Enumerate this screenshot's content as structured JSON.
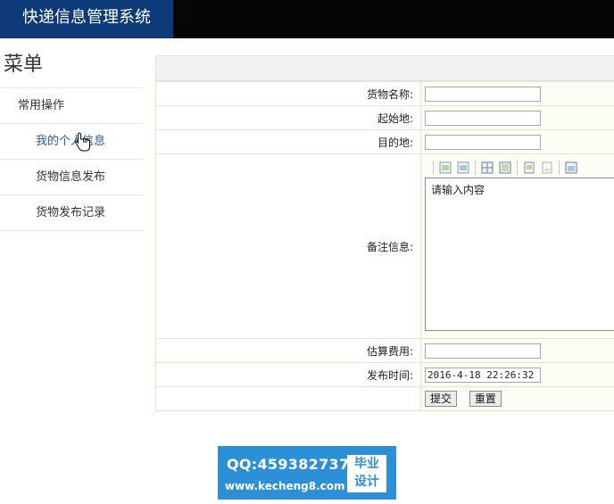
{
  "header": {
    "title": "快递信息管理系统"
  },
  "sidebar": {
    "title": "菜单",
    "items": [
      {
        "label": "常用操作"
      },
      {
        "label": "我的个人信息"
      },
      {
        "label": "货物信息发布"
      },
      {
        "label": "货物发布记录"
      }
    ]
  },
  "form": {
    "fields": {
      "name": {
        "label": "货物名称:",
        "value": ""
      },
      "origin": {
        "label": "起始地:",
        "value": ""
      },
      "dest": {
        "label": "目的地:",
        "value": ""
      },
      "remark": {
        "label": "备注信息:",
        "placeholder": "请输入内容"
      },
      "cost": {
        "label": "估算费用:",
        "value": ""
      },
      "time": {
        "label": "发布时间:",
        "value": "2016-4-18 22:26:32"
      }
    },
    "buttons": {
      "submit": "提交",
      "reset": "重置"
    }
  },
  "watermark": {
    "qq": "QQ:459382737",
    "url": "www.kecheng8.com",
    "badge_line1": "毕业",
    "badge_line2": "设计"
  },
  "colors": {
    "header_bg": "#050505",
    "title_bg": "#0d3b7a",
    "active_link": "#2d5f92",
    "watermark_bg": "#2d8fd6"
  },
  "icons": [
    "pointer-hand-cursor",
    "editor-toolbar-buttons"
  ]
}
